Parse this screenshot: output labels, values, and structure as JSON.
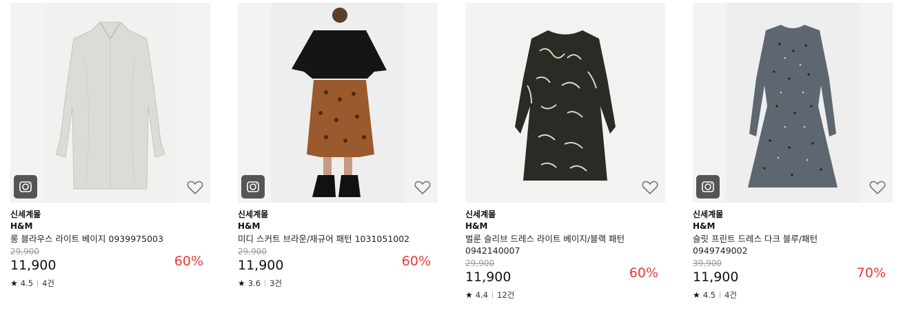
{
  "products": [
    {
      "store": "신세계몰",
      "brand": "H&M",
      "name": "롱 블라우스 라이트 베이지 0939975003",
      "original_price": "29,900",
      "price": "11,900",
      "discount": "60%",
      "rating": "4.5",
      "reviews": "4건",
      "icons": {
        "camera": "camera-icon",
        "wishlist": "heart-icon"
      }
    },
    {
      "store": "신세계몰",
      "brand": "H&M",
      "name": "미디 스커트 브라운/재규어 패턴 1031051002",
      "original_price": "29,900",
      "price": "11,900",
      "discount": "60%",
      "rating": "3.6",
      "reviews": "3건",
      "icons": {
        "camera": "camera-icon",
        "wishlist": "heart-icon"
      }
    },
    {
      "store": "신세계몰",
      "brand": "H&M",
      "name": "벌룬 슬리브 드레스 라이트 베이지/블랙 패턴 0942140007",
      "original_price": "29,900",
      "price": "11,900",
      "discount": "60%",
      "rating": "4.4",
      "reviews": "12건",
      "icons": {
        "camera": "camera-icon",
        "wishlist": "heart-icon"
      }
    },
    {
      "store": "신세계몰",
      "brand": "H&M",
      "name": "슬릿 프린트 드레스 다크 블루/패턴 0949749002",
      "original_price": "39,900",
      "price": "11,900",
      "discount": "70%",
      "rating": "4.5",
      "reviews": "4건",
      "icons": {
        "camera": "camera-icon",
        "wishlist": "heart-icon"
      }
    }
  ],
  "colors": {
    "discount": "#e53935",
    "original_price": "#999999",
    "thumb_bg": "#f3f3f3",
    "camera_bg": "#555555"
  }
}
